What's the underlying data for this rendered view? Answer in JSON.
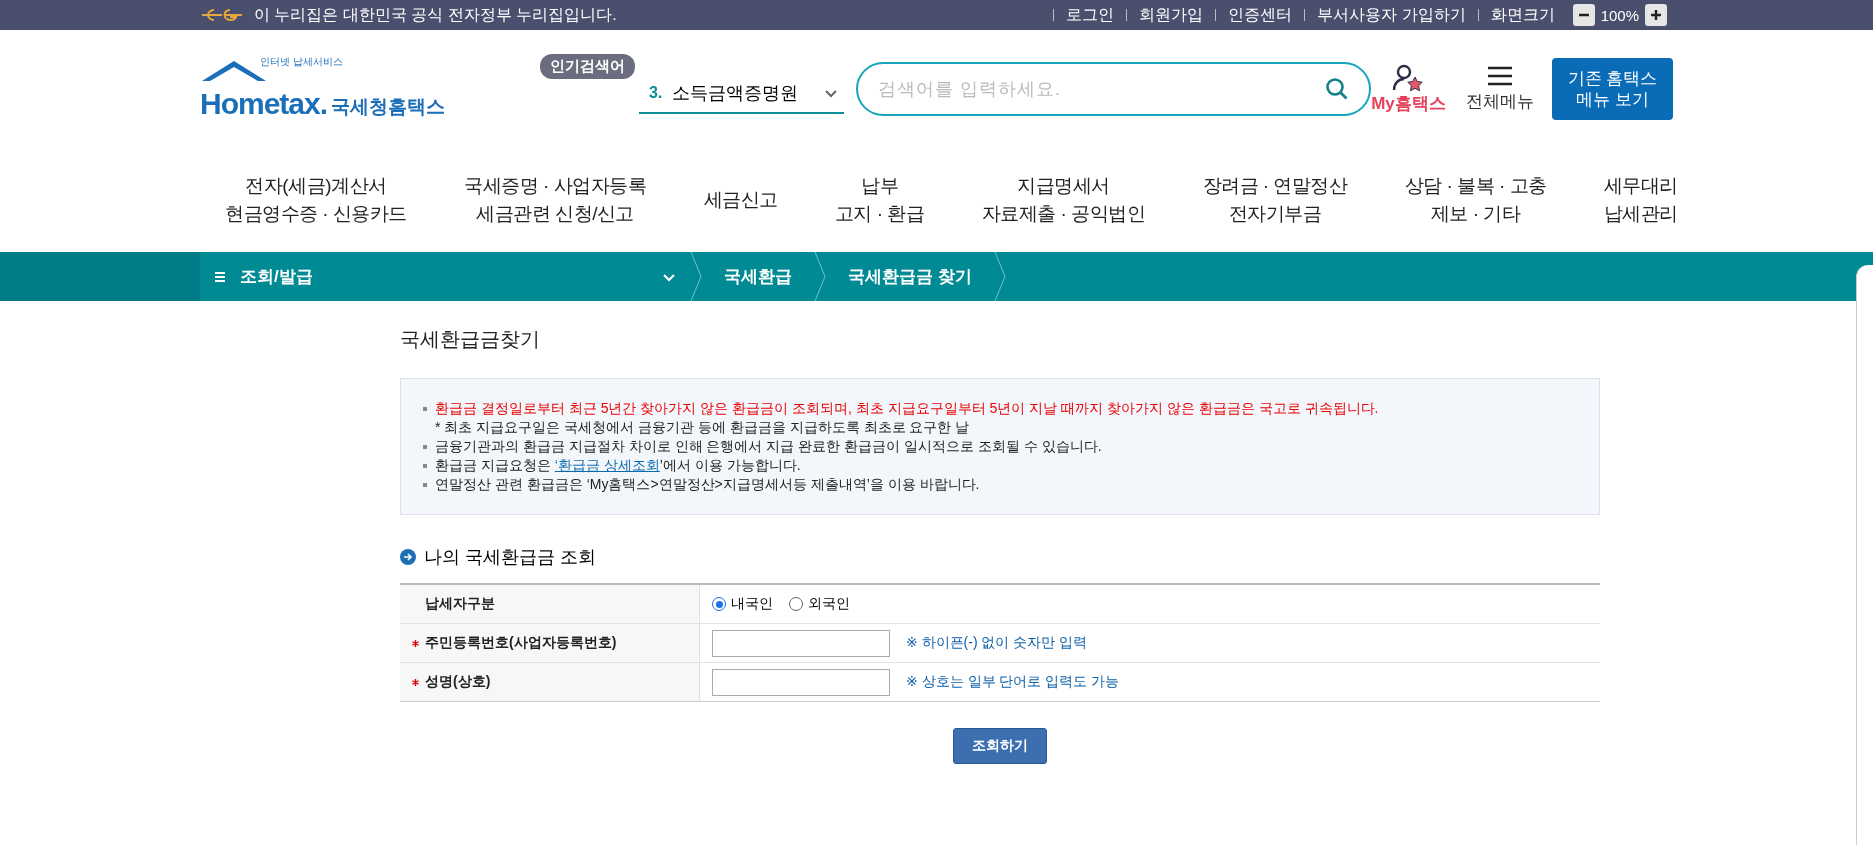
{
  "gov_banner": {
    "text": "이 누리집은 대한민국 공식 전자정부 누리집입니다.",
    "links": [
      "로그인",
      "회원가입",
      "인증센터",
      "부서사용자 가입하기"
    ],
    "zoom_label": "화면크기",
    "zoom_value": "100%"
  },
  "header": {
    "logo": {
      "tagline": "인터넷 납세서비스",
      "wordmark": "Hometax.",
      "name": "국세청홈택스"
    },
    "popular_badge": "인기검색어",
    "popular_rank": "3.",
    "popular_term": "소득금액증명원",
    "search": {
      "placeholder": "검색어를 입력하세요."
    },
    "my_menu": "My홈택스",
    "all_menu": "전체메뉴",
    "legacy_button": [
      "기존 홈택스",
      "메뉴 보기"
    ]
  },
  "nav": [
    {
      "lines": [
        "전자(세금)계산서",
        "현금영수증 · 신용카드"
      ]
    },
    {
      "lines": [
        "국세증명 · 사업자등록",
        "세금관련 신청/신고"
      ]
    },
    {
      "lines": [
        "세금신고"
      ]
    },
    {
      "lines": [
        "납부",
        "고지 · 환급"
      ]
    },
    {
      "lines": [
        "지급명세서",
        "자료제출 · 공익법인"
      ]
    },
    {
      "lines": [
        "장려금 · 연말정산",
        "전자기부금"
      ]
    },
    {
      "lines": [
        "상담 · 불복 · 고충",
        "제보 · 기타"
      ]
    },
    {
      "lines": [
        "세무대리",
        "납세관리"
      ]
    }
  ],
  "breadcrumb": {
    "menu": "조회/발급",
    "crumbs": [
      "국세환급",
      "국세환급금 찾기"
    ]
  },
  "page_title": "국세환급금찾기",
  "notices": [
    {
      "kind": "warning",
      "text": "환급금 결정일로부터 최근 5년간 찾아가지 않은 환급금이 조회되며, 최초 지급요구일부터 5년이 지날 때까지 찾아가지 않은 환급금은 국고로 귀속됩니다."
    },
    {
      "kind": "note",
      "text": "* 최초 지급요구일은 국세청에서 금융기관 등에 환급금을 지급하도록 최초로 요구한 날"
    },
    {
      "kind": "normal",
      "text": "금융기관과의 환급금 지급절차 차이로 인해 은행에서 지급 완료한 환급금이 일시적으로 조회될 수 있습니다."
    },
    {
      "kind": "link",
      "before": "환급금 지급요청은 ",
      "link": "‘환급금 상세조회",
      "after": "’에서 이용 가능합니다."
    },
    {
      "kind": "normal",
      "text": "연말정산 관련 환급금은 ‘My홈택스>연말정산>지급명세서등 제출내역’을 이용 바랍니다."
    }
  ],
  "section_title": "나의 국세환급금 조회",
  "form_rows": [
    {
      "kind": "radio",
      "label": "납세자구분",
      "required": false,
      "options": [
        {
          "label": "내국인",
          "selected": true
        },
        {
          "label": "외국인",
          "selected": false
        }
      ]
    },
    {
      "kind": "input",
      "label": "주민등록번호(사업자등록번호)",
      "required": true,
      "hint": "※ 하이픈(-) 없이 숫자만 입력"
    },
    {
      "kind": "input",
      "label": "성명(상호)",
      "required": true,
      "hint": "※ 상호는 일부 단어로 입력도 가능"
    }
  ],
  "submit": "조회하기"
}
